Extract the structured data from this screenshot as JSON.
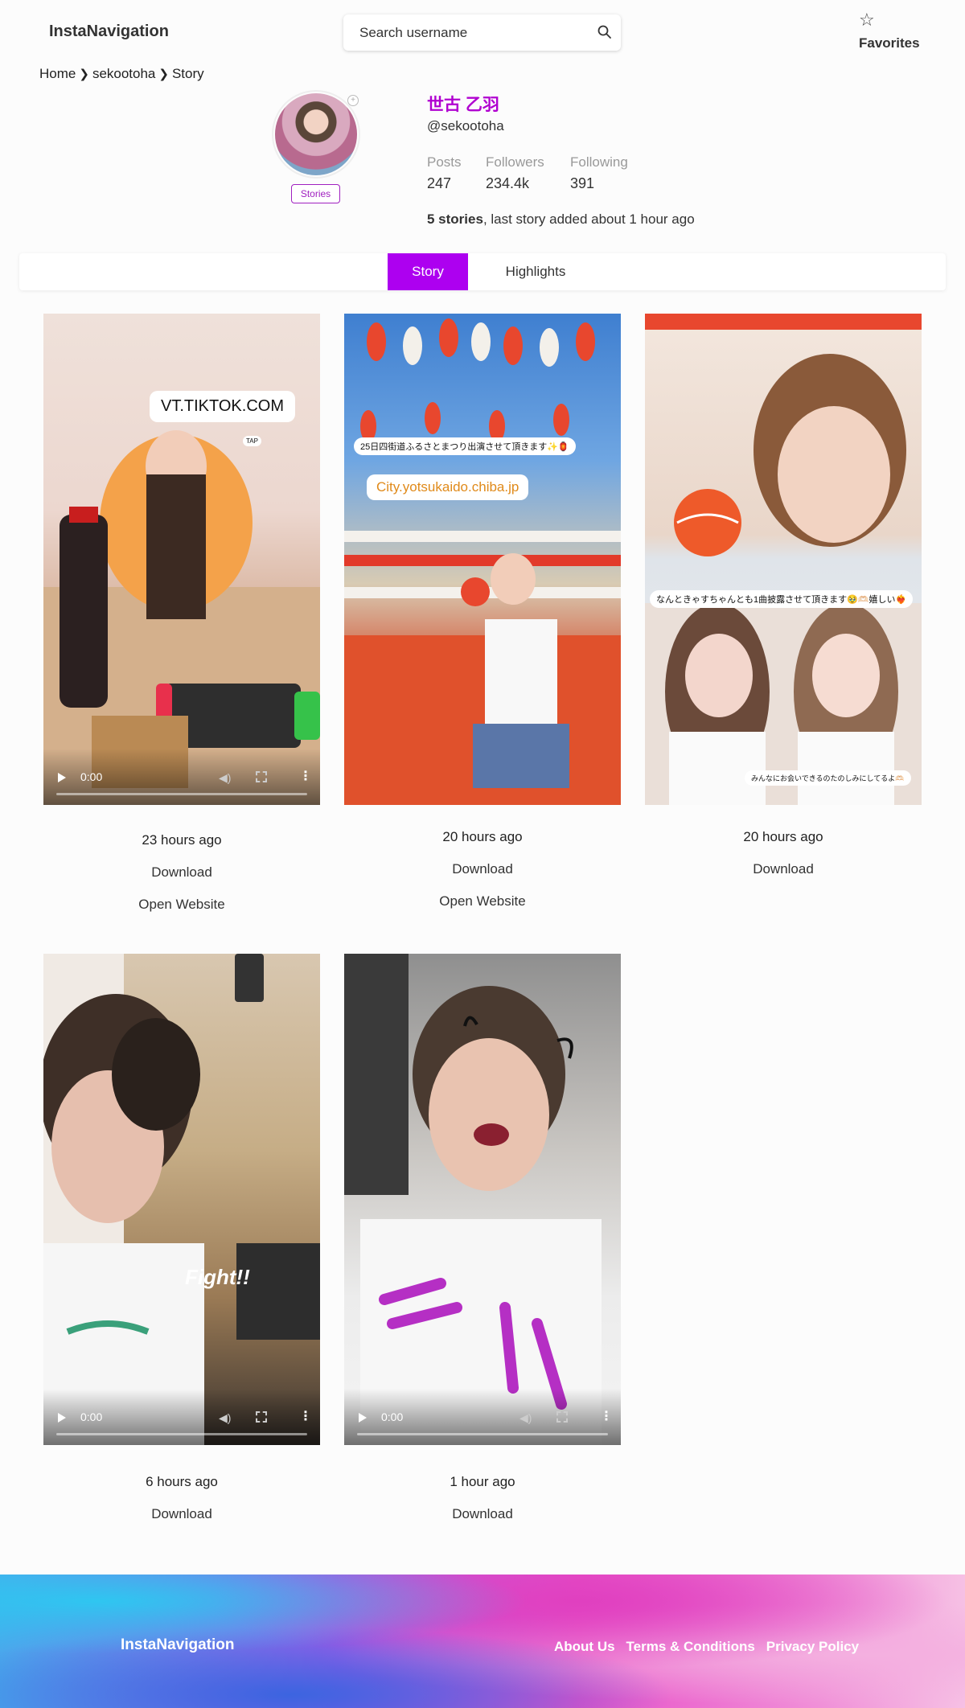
{
  "header": {
    "logo": "InstaNavigation",
    "search_placeholder": "Search username",
    "favorites_label": "Favorites"
  },
  "breadcrumb": [
    "Home",
    "sekootoha",
    "Story"
  ],
  "profile": {
    "display_name": "󠁧󠁢世古 乙羽󠁧󠁢",
    "handle": "@sekootoha",
    "stories_badge": "Stories",
    "stats": [
      {
        "label": "Posts",
        "value": "247"
      },
      {
        "label": "Followers",
        "value": "234.4k"
      },
      {
        "label": "Following",
        "value": "391"
      }
    ],
    "stories_count_bold": "5 stories",
    "stories_info_rest": ", last story added about 1 hour ago"
  },
  "tabs": [
    {
      "label": "Story",
      "active": true
    },
    {
      "label": "Highlights",
      "active": false
    }
  ],
  "stories": [
    {
      "time": "23 hours ago",
      "actions": [
        "Download",
        "Open Website"
      ],
      "is_video": true,
      "video_time": "0:00",
      "overlay_texts": [
        "VT.TIKTOK.COM",
        "TAP"
      ]
    },
    {
      "time": "20 hours ago",
      "actions": [
        "Download",
        "Open Website"
      ],
      "is_video": false,
      "overlay_texts": [
        "25日四街道ふるさとまつり出演させて頂きます✨🏮",
        "City.yotsukaido.chiba.jp"
      ]
    },
    {
      "time": "20 hours ago",
      "actions": [
        "Download"
      ],
      "is_video": false,
      "overlay_texts": [
        "なんときゃすちゃんとも1曲披露させて頂きます🥹🫶🏻嬉しい❤️‍🔥",
        "みんなにお会いできるのたのしみにしてるよ🫶🏻"
      ]
    },
    {
      "time": "6 hours ago",
      "actions": [
        "Download"
      ],
      "is_video": true,
      "video_time": "0:00",
      "overlay_texts": [
        "Fight!!"
      ]
    },
    {
      "time": "1 hour ago",
      "actions": [
        "Download"
      ],
      "is_video": true,
      "video_time": "0:00",
      "overlay_texts": []
    }
  ],
  "footer": {
    "brand": "InstaNavigation",
    "links": [
      "About Us",
      "Terms & Conditions",
      "Privacy Policy"
    ]
  },
  "colors": {
    "accent": "#ad00f0",
    "name": "#b000d0"
  }
}
